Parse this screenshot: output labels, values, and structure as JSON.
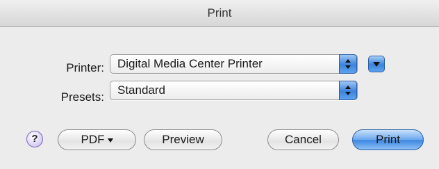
{
  "window": {
    "title": "Print"
  },
  "form": {
    "printer_label": "Printer:",
    "printer_value": "Digital Media Center Printer",
    "presets_label": "Presets:",
    "presets_value": "Standard"
  },
  "buttons": {
    "help": "?",
    "pdf": "PDF",
    "preview": "Preview",
    "cancel": "Cancel",
    "print": "Print"
  },
  "icons": [
    "stepper-arrows-icon",
    "disclosure-triangle-icon",
    "help-icon",
    "pdf-menu-caret-icon"
  ],
  "colors": {
    "accent": "#3b83dc",
    "window_bg": "#ececec"
  }
}
